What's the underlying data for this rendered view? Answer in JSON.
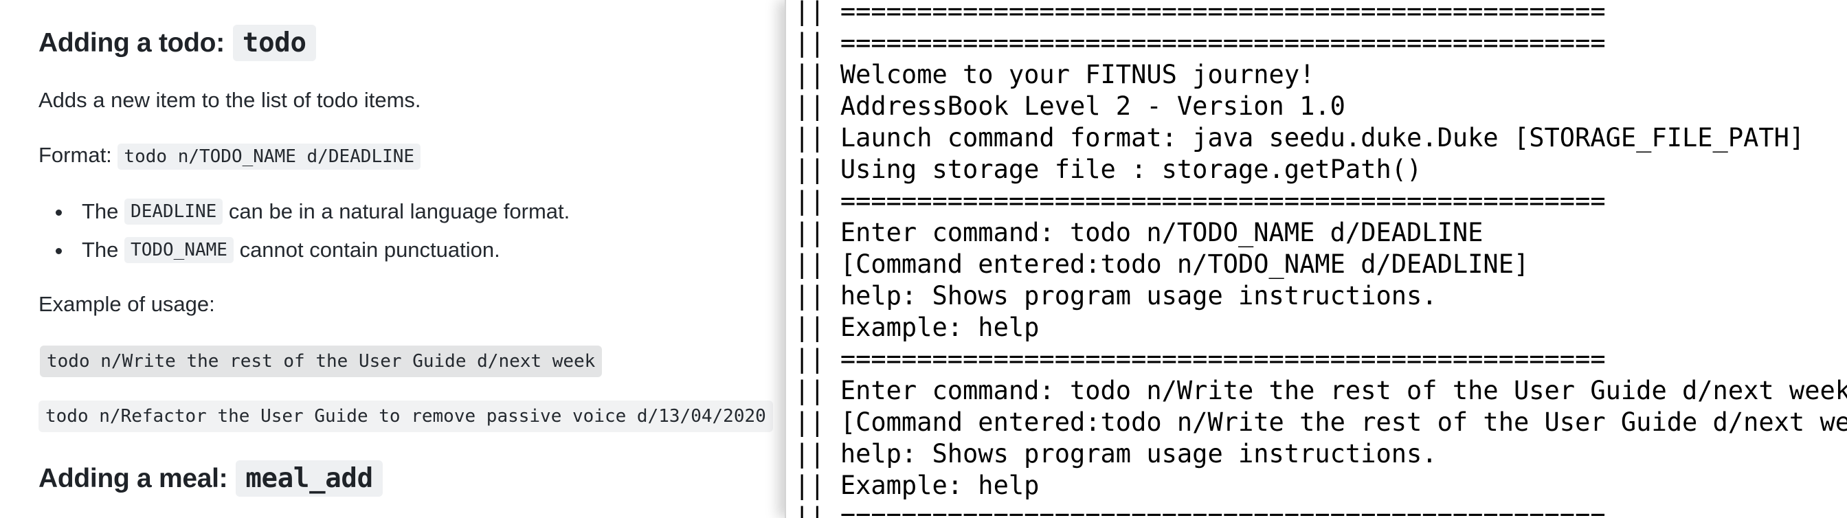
{
  "doc": {
    "todo_heading": "Adding a todo:",
    "todo_heading_code": "todo",
    "todo_description": "Adds a new item to the list of todo items.",
    "format_label": "Format:",
    "format_code": "todo n/TODO_NAME d/DEADLINE",
    "bullets": [
      {
        "prefix": "The",
        "code": "DEADLINE",
        "suffix": "can be in a natural language format."
      },
      {
        "prefix": "The",
        "code": "TODO_NAME",
        "suffix": "cannot contain punctuation."
      }
    ],
    "example_label": "Example of usage:",
    "examples": [
      "todo n/Write the rest of the User Guide d/next week",
      "todo n/Refactor the User Guide to remove passive voice d/13/04/2020"
    ],
    "meal_heading": "Adding a meal:",
    "meal_heading_code": "meal_add"
  },
  "terminal": {
    "lines": [
      "|| ==================================================",
      "|| ==================================================",
      "|| Welcome to your FITNUS journey!",
      "|| AddressBook Level 2 - Version 1.0",
      "|| Launch command format: java seedu.duke.Duke [STORAGE_FILE_PATH]",
      "|| Using storage file : storage.getPath()",
      "|| ==================================================",
      "|| Enter command: todo n/TODO_NAME d/DEADLINE",
      "|| [Command entered:todo n/TODO_NAME d/DEADLINE]",
      "|| help: Shows program usage instructions.",
      "|| Example: help",
      "|| ==================================================",
      "|| Enter command: todo n/Write the rest of the User Guide d/next week",
      "|| [Command entered:todo n/Write the rest of the User Guide d/next week]",
      "|| help: Shows program usage instructions.",
      "|| Example: help",
      "|| =================================================="
    ]
  }
}
